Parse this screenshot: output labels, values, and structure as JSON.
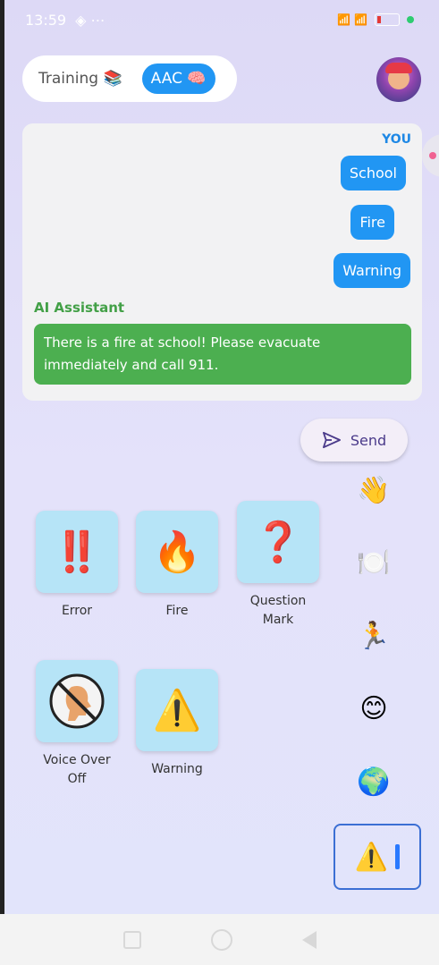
{
  "status": {
    "time": "13:59",
    "icons_left": "◈ ⋯",
    "icons_right": "📶 📶",
    "battery_icon": "battery-icon"
  },
  "mode": {
    "training_label": "Training 📚",
    "aac_label": "AAC 🧠",
    "active": "AAC"
  },
  "chat": {
    "you_label": "YOU",
    "user_messages": [
      "School",
      "Fire",
      "Warning"
    ],
    "ai_label": "AI Assistant",
    "ai_message": "There is a fire at school! Please evacuate immediately and call 911."
  },
  "send": {
    "label": "Send",
    "icon": "send-icon"
  },
  "tiles": [
    {
      "label": "Error",
      "emoji": "‼️",
      "icon": "double-exclamation-icon"
    },
    {
      "label": "Fire",
      "emoji": "🔥",
      "icon": "fire-icon"
    },
    {
      "label": "Question\nMark",
      "emoji": "❓",
      "icon": "question-mark-icon"
    },
    {
      "label": "Voice Over\nOff",
      "emoji": "🚫",
      "icon": "voice-off-icon"
    },
    {
      "label": "Warning",
      "emoji": "⚠️",
      "icon": "warning-icon"
    }
  ],
  "categories": [
    {
      "emoji": "👋",
      "icon": "waving-hand-icon"
    },
    {
      "emoji": "🍽️",
      "icon": "plate-icon"
    },
    {
      "emoji": "🏃",
      "icon": "running-icon"
    },
    {
      "emoji": "😊",
      "icon": "smiley-icon"
    },
    {
      "emoji": "🌍",
      "icon": "globe-icon"
    }
  ],
  "active_category": {
    "emoji": "⚠️",
    "icon": "warning-icon"
  },
  "colors": {
    "accent": "#2196f3",
    "ai": "#4caf50",
    "tile_bg": "#b6e4f7"
  }
}
